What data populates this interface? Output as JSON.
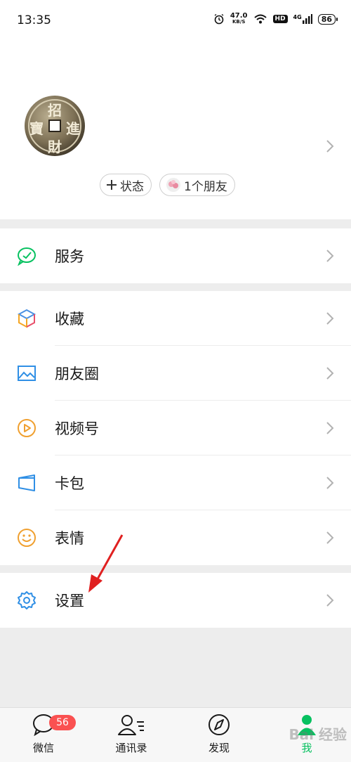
{
  "status_bar": {
    "time": "13:35",
    "speed_value": "47.0",
    "speed_unit": "KB/S",
    "hd_label": "HD",
    "network_label": "4G",
    "battery": "86"
  },
  "profile": {
    "avatar_chars": [
      "招",
      "進",
      "財",
      "寶"
    ],
    "status_chip": "状态",
    "friends_chip": "1个朋友"
  },
  "menu": {
    "service": "服务",
    "favorites": "收藏",
    "moments": "朋友圈",
    "channels": "视频号",
    "cards": "卡包",
    "stickers": "表情",
    "settings": "设置"
  },
  "tabbar": {
    "chats": "微信",
    "chats_badge": "56",
    "contacts": "通讯录",
    "discover": "发现",
    "me": "我"
  },
  "watermark": "Bai 经验",
  "colors": {
    "accent": "#07c160",
    "badge": "#fa5151",
    "annotation_arrow": "#e02020"
  }
}
